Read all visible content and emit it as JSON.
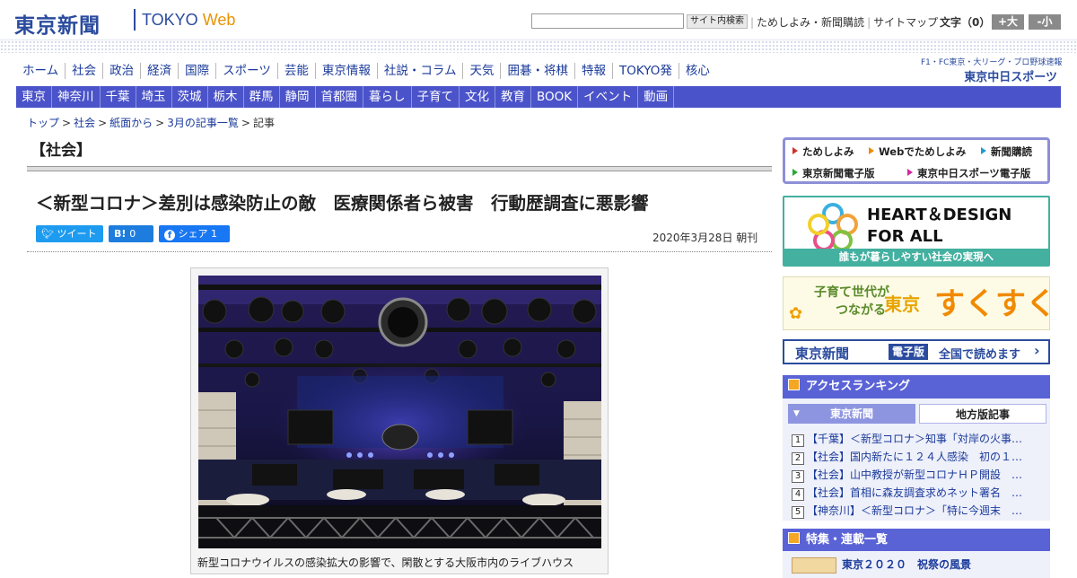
{
  "header": {
    "logo_jp": "東京新聞",
    "logo_en_a": "TOKYO ",
    "logo_en_b": "Web",
    "search_button": "サイト内検索",
    "links": [
      "ためしよみ・新聞購読",
      "サイトマップ"
    ],
    "font_size_label": "文字（0）",
    "font_large": "+大",
    "font_small": "-小"
  },
  "nav_main": [
    "ホーム",
    "社会",
    "政治",
    "経済",
    "国際",
    "スポーツ",
    "芸能",
    "東京情報",
    "社説・コラム",
    "天気",
    "囲碁・将棋",
    "特報",
    "TOKYO発",
    "核心"
  ],
  "chunichi": {
    "line1": "F1・FC東京・大リーグ・プロ野球速報",
    "line2": "東京中日スポーツ"
  },
  "nav_sub": [
    "東京",
    "神奈川",
    "千葉",
    "埼玉",
    "茨城",
    "栃木",
    "群馬",
    "静岡",
    "首都圏",
    "暮らし",
    "子育て",
    "文化",
    "教育",
    "BOOK",
    "イベント",
    "動画"
  ],
  "breadcrumb": {
    "items": [
      "トップ",
      "社会",
      "紙面から",
      "3月の記事一覧"
    ],
    "current": "記事",
    "sep": ">"
  },
  "section_title": "【社会】",
  "article": {
    "headline": "＜新型コロナ＞差別は感染防止の敵　医療関係者ら被害　行動歴調査に悪影響",
    "date": "2020年3月28日 朝刊",
    "caption": "新型コロナウイルスの感染拡大の影響で、閑散とする大阪市内のライブハウス"
  },
  "share": {
    "tweet": "ツイート",
    "hatena_icon": "B!",
    "hatena_count": "0",
    "fb_label": "シェア",
    "fb_count": "1"
  },
  "trial_links": [
    "ためしよみ",
    "Webでためしよみ",
    "新聞購読",
    "東京新聞電子版",
    "東京中日スポーツ電子版"
  ],
  "banner_heart": {
    "line1": "HEART＆DESIGN",
    "line2": "FOR ALL",
    "tagline": "誰もが暮らしやすい社会の実現へ"
  },
  "banner_sukusuku": {
    "line1": "子育て世代が",
    "line2": "つながる",
    "brand": "東京",
    "name": "すくすく"
  },
  "banner_epaper": {
    "brand": "東京新聞",
    "badge": "電子版",
    "text": "全国で読めます"
  },
  "ranking": {
    "title": "アクセスランキング",
    "tab_active": "東京新聞",
    "tab_other": "地方版記事",
    "items": [
      "【千葉】＜新型コロナ＞知事「対岸の火事…",
      "【社会】国内新たに１２４人感染　初の１…",
      "【社会】山中教授が新型コロナＨＰ開設　…",
      "【社会】首相に森友調査求めネット署名　…",
      "【神奈川】＜新型コロナ＞「特に今週末　…"
    ]
  },
  "features": {
    "title": "特集・連載一覧",
    "first_item": "東京２０２０　祝祭の風景"
  },
  "colors": {
    "brand": "#2a4b9e",
    "nav_bar": "#4a53c9",
    "accent_orange": "#e89300",
    "teal": "#43b0a0"
  }
}
